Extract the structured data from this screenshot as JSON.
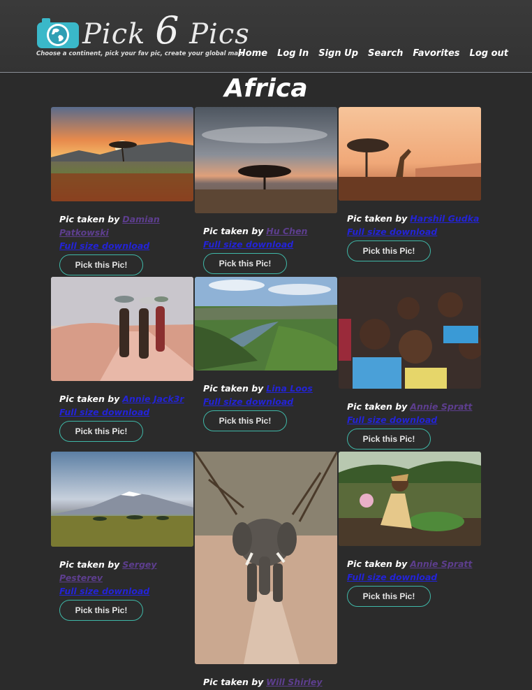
{
  "brand": {
    "name_prefix": "Pick ",
    "name_number": "6",
    "name_suffix": " Pics",
    "tagline": "Choose a continent, pick your fav pic, create your global map",
    "logo_icon": "camera-globe-icon"
  },
  "nav": [
    "Home",
    "Log In",
    "Sign Up",
    "Search",
    "Favorites",
    "Log out"
  ],
  "page_title": "Africa",
  "caption_prefix": "Pic taken by",
  "download_label": "Full size download",
  "pick_label": "Pick this Pic!",
  "cards": [
    {
      "author": "Damian Patkowski",
      "author_visited": true,
      "scene": "acacia sunset savanna"
    },
    {
      "author": "Hu Chen",
      "author_visited": true,
      "scene": "lone tree under cloudy sky"
    },
    {
      "author": "Harshil Gudka",
      "author_visited": false,
      "scene": "giraffe and acacia at dusk"
    },
    {
      "author": "Annie Jack3r",
      "author_visited": false,
      "scene": "children carrying bowls on dirt road"
    },
    {
      "author": "Lina Loos",
      "author_visited": false,
      "scene": "green canyon with river"
    },
    {
      "author": "Annie Spratt",
      "author_visited": true,
      "scene": "smiling children group"
    },
    {
      "author": "Sergey Pesterev",
      "author_visited": true,
      "scene": "Kilimanjaro over plains"
    },
    {
      "author": "Will Shirley",
      "author_visited": true,
      "scene": "elephant on sandy path"
    },
    {
      "author": "Annie Spratt",
      "author_visited": true,
      "scene": "woman farming with baby"
    }
  ],
  "colors": {
    "background": "#2b2b2b",
    "header": "#363636",
    "button_border": "#3fb8a8",
    "link": "#2323d6",
    "visited_link": "#5d3e8e"
  }
}
